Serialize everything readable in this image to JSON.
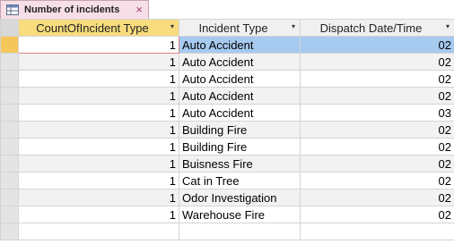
{
  "tab": {
    "title": "Number of incidents",
    "icon": "query-icon",
    "close": "×",
    "accent": "#f7dfe8"
  },
  "columns": [
    {
      "label": "CountOfIncident Type"
    },
    {
      "label": "Incident Type"
    },
    {
      "label": "Dispatch Date/Time"
    }
  ],
  "rows": [
    {
      "count": "1",
      "type": "Auto Accident",
      "date": "02"
    },
    {
      "count": "1",
      "type": "Auto Accident",
      "date": "02"
    },
    {
      "count": "1",
      "type": "Auto Accident",
      "date": "02"
    },
    {
      "count": "1",
      "type": "Auto Accident",
      "date": "02"
    },
    {
      "count": "1",
      "type": "Auto Accident",
      "date": "03"
    },
    {
      "count": "1",
      "type": "Building Fire",
      "date": "02"
    },
    {
      "count": "1",
      "type": "Building Fire",
      "date": "02"
    },
    {
      "count": "1",
      "type": "Buisness Fire",
      "date": "02"
    },
    {
      "count": "1",
      "type": "Cat in Tree",
      "date": "02"
    },
    {
      "count": "1",
      "type": "Odor Investigation",
      "date": "02"
    },
    {
      "count": "1",
      "type": "Warehouse Fire",
      "date": "02"
    }
  ],
  "dropdown_glyph": "▾"
}
